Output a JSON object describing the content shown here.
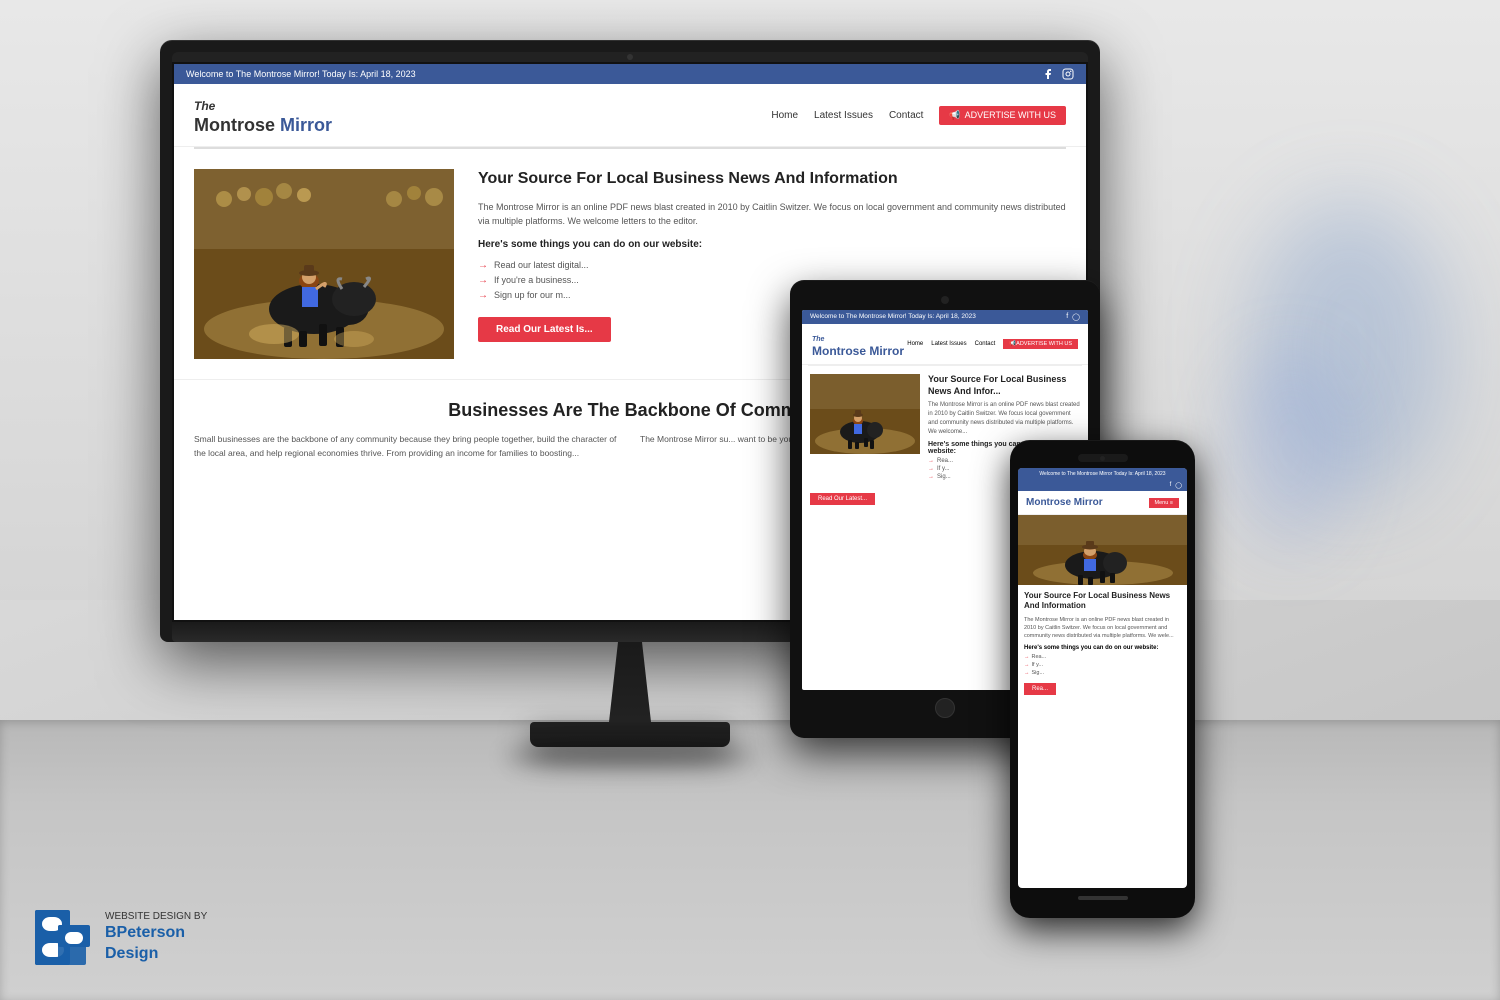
{
  "background": {
    "wall_color": "#e0e0e0",
    "floor_color": "#b8b8b8"
  },
  "monitor": {
    "website": {
      "topbar": {
        "text": "Welcome to The Montrose Mirror! Today Is: April 18, 2023",
        "social_icons": [
          "facebook",
          "instagram"
        ]
      },
      "nav": {
        "logo_text": "Montrose",
        "logo_accent": "Mirror",
        "links": [
          "Home",
          "Latest Issues",
          "Contact"
        ],
        "advertise_btn": "ADVERTISE WITH US"
      },
      "hero": {
        "title": "Your Source For Local Business News And Information",
        "description": "The Montrose Mirror is an online PDF news blast created in 2010 by Caitlin Switzer. We focus on local government and community news distributed via multiple platforms. We welcome letters to the editor.",
        "subtitle": "Here's some things you can do on our website:",
        "list_items": [
          "Read our latest digital...",
          "If you're a business...",
          "Sign up for our m..."
        ],
        "read_btn": "Read Our Latest Is..."
      },
      "section2": {
        "title": "Businesses Are The Backbone Of Comm...",
        "col1": "Small businesses are the backbone of any community because they bring people together, build the character of the local area, and help regional economies thrive. From providing an income for families to boosting...",
        "col2": "The Montrose Mirror su... want to be your main s... your community."
      }
    }
  },
  "tablet": {
    "website": {
      "topbar_text": "Welcome to The Montrose Mirror! Today Is: April 18, 2023",
      "logo_text": "Montrose",
      "logo_accent": "Mirror",
      "nav_links": [
        "Home",
        "Latest Issues",
        "Contact"
      ],
      "advertise_btn": "ADVERTISE WITH US",
      "hero_title": "Your Source For Local Business News And Infor...",
      "hero_desc": "The Montrose Mirror is an online PDF news blast created in 2010 by Caitlin Switzer. We focus local government and community news distributed via multiple platforms. We welcome...",
      "hero_subtitle": "Here's some things you can do on our website:",
      "list_items": [
        "Rea...",
        "If y...",
        "Sig..."
      ],
      "read_btn": "Read Our Latest..."
    }
  },
  "phone": {
    "website": {
      "topbar_text": "Welcome to The Montrose Mirror Today Is: April 18, 2023",
      "logo_text": "Montrose",
      "logo_accent": "Mirror",
      "menu_btn": "Menu ≡",
      "hero_title": "Your Source For Local Business News And Information",
      "hero_desc": "The Montrose Mirror is an online PDF news blast created in 2010 by Caitlin Switzer. We focus on local government and community news distributed via multiple platforms. We wele...",
      "hero_subtitle": "Here's some things you can do on our website:",
      "list_items": [
        "Rea...",
        "If y...",
        "Sig..."
      ],
      "read_btn": "Rea..."
    }
  },
  "branding": {
    "website_design_by": "WEBSITE DESIGN BY",
    "company_name": "BPeterson",
    "company_suffix": "Design"
  }
}
